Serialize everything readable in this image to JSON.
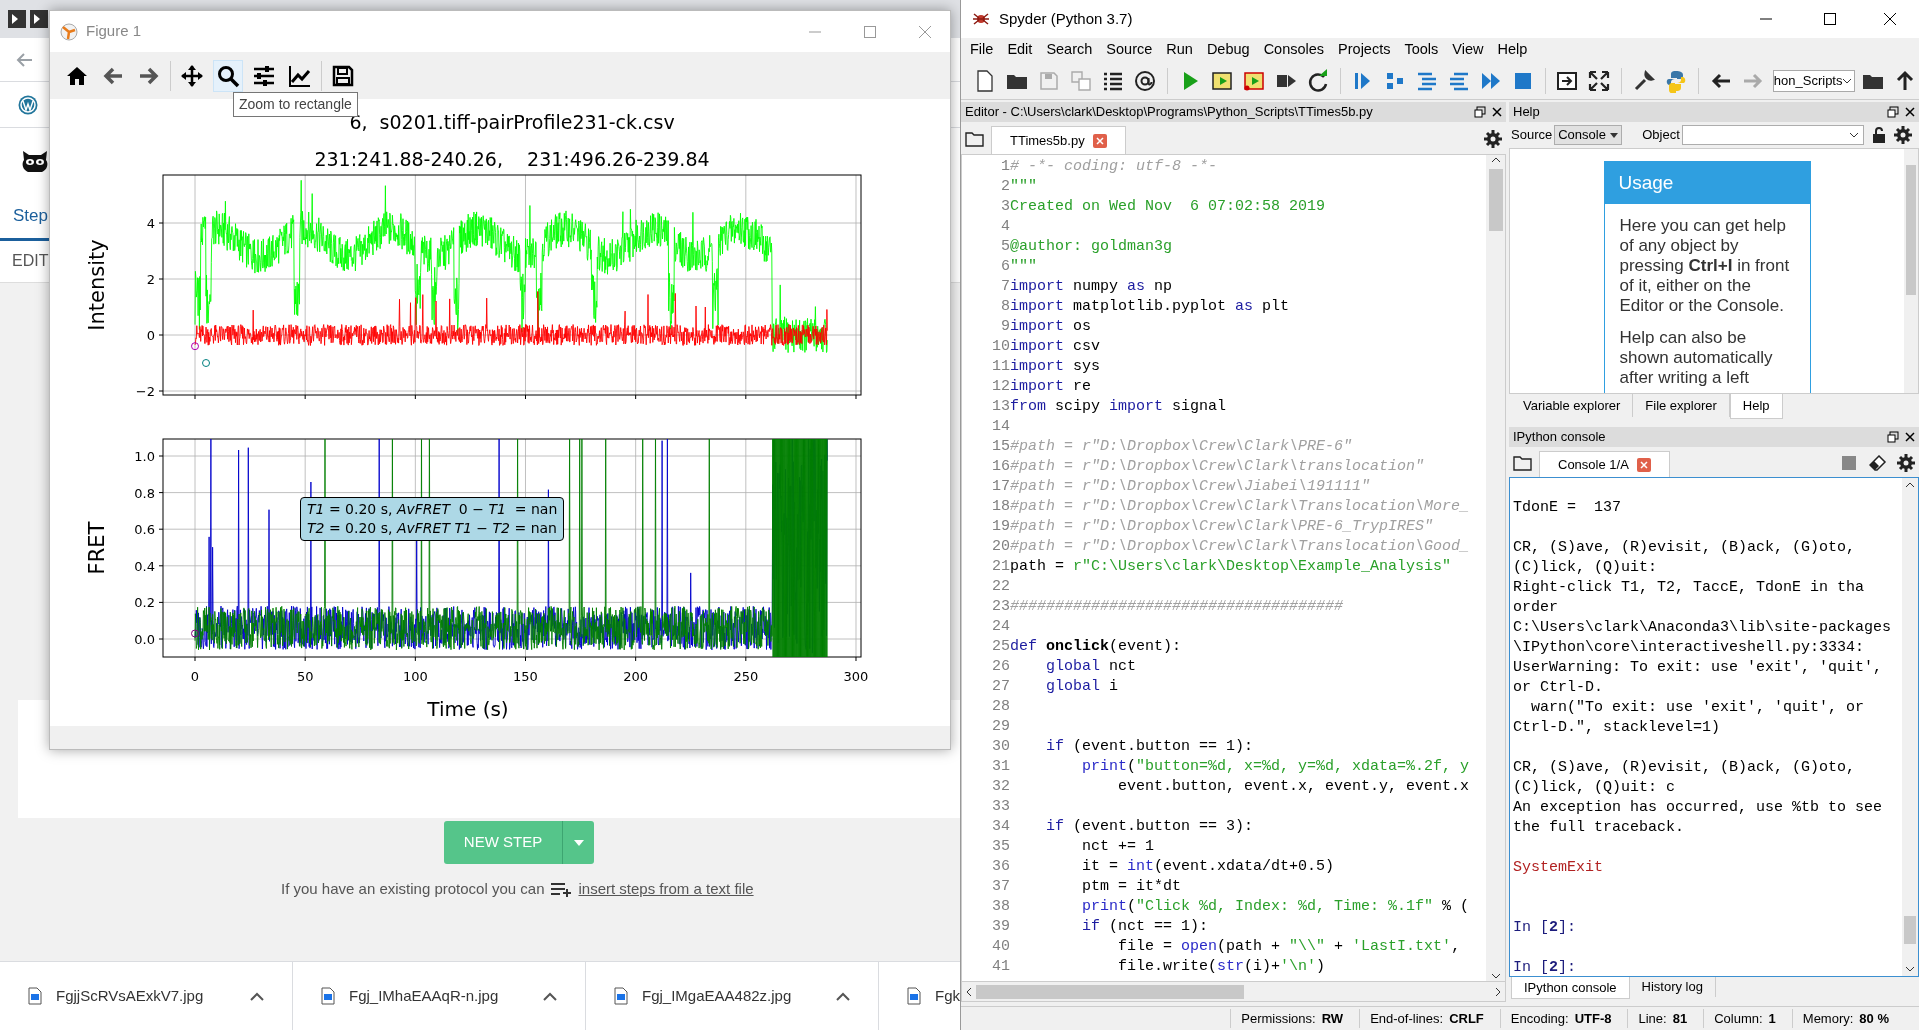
{
  "browser": {
    "tab_label": "Step",
    "edit_label": "EDIT",
    "new_step_button": "NEW STEP",
    "import_hint": "If you have an existing protocol you can",
    "import_link": "insert steps from a text file"
  },
  "downloads": [
    {
      "name": "FgjjScRVsAExkV7.jpg"
    },
    {
      "name": "Fgj_IMhaEAAqR-n.jpg"
    },
    {
      "name": "Fgj_IMgaEAA482z.jpg"
    },
    {
      "name": "Fgk"
    }
  ],
  "figure": {
    "window_title": "Figure 1",
    "tools": [
      {
        "kind": "home",
        "highlighted": false
      },
      {
        "kind": "back",
        "highlighted": false
      },
      {
        "kind": "forward",
        "highlighted": false
      },
      {
        "kind": "pan",
        "highlighted": false
      },
      {
        "kind": "zoom",
        "highlighted": true
      },
      {
        "kind": "sliders",
        "highlighted": false
      },
      {
        "kind": "curve",
        "highlighted": false
      },
      {
        "kind": "save",
        "highlighted": false
      }
    ],
    "tooltip": "Zoom to rectangle",
    "title_lines": [
      "6,  s0201.tiff-pairProfile231-ck.csv",
      "231:241.88-240.26,    231:496.26-239.84"
    ],
    "axes": [
      {
        "ylabel": "Intensity",
        "yticks": [
          "4",
          "2",
          "0",
          "−2"
        ]
      },
      {
        "ylabel": "FRET",
        "yticks": [
          "1.0",
          "0.8",
          "0.6",
          "0.4",
          "0.2",
          "0.0"
        ],
        "annotation": [
          "*T1* = 0.20 s, *AvFRET*  0 − *T1*  = nan",
          "*T2* = 0.20 s, *AvFRET* *T1* − *T2* = nan"
        ]
      }
    ],
    "xticks": [
      "0",
      "50",
      "100",
      "150",
      "200",
      "250",
      "300"
    ],
    "xlabel": "Time (s)"
  },
  "spyder": {
    "window_title": "Spyder (Python 3.7)",
    "menu": [
      "File",
      "Edit",
      "Search",
      "Source",
      "Run",
      "Debug",
      "Consoles",
      "Projects",
      "Tools",
      "View",
      "Help"
    ],
    "path_combo": "hon_Scripts",
    "editor": {
      "pane_title": "Editor - C:\\Users\\clark\\Desktop\\Programs\\Python_Scripts\\TTimes5b.py",
      "tab": "TTimes5b.py",
      "lines": [
        {
          "n": "1",
          "tokens": [
            {
              "kind": "comment",
              "text": "# -*- coding: utf-8 -*-"
            }
          ]
        },
        {
          "n": "2",
          "tokens": [
            {
              "kind": "string",
              "text": "\"\"\""
            }
          ]
        },
        {
          "n": "3",
          "tokens": [
            {
              "kind": "string",
              "text": "Created on Wed Nov  6 07:02:58 2019"
            }
          ]
        },
        {
          "n": "4"
        },
        {
          "n": "5",
          "tokens": [
            {
              "kind": "string",
              "text": "@author: goldman3g"
            }
          ]
        },
        {
          "n": "6",
          "tokens": [
            {
              "kind": "string",
              "text": "\"\"\""
            }
          ]
        },
        {
          "n": "7",
          "tokens": [
            {
              "kind": "keyword",
              "text": "import"
            },
            {
              "kind": "plain",
              "text": " numpy "
            },
            {
              "kind": "keyword",
              "text": "as"
            },
            {
              "kind": "plain",
              "text": " np"
            }
          ]
        },
        {
          "n": "8",
          "tokens": [
            {
              "kind": "keyword",
              "text": "import"
            },
            {
              "kind": "plain",
              "text": " matplotlib.pyplot "
            },
            {
              "kind": "keyword",
              "text": "as"
            },
            {
              "kind": "plain",
              "text": " plt"
            }
          ]
        },
        {
          "n": "9",
          "tokens": [
            {
              "kind": "keyword",
              "text": "import"
            },
            {
              "kind": "plain",
              "text": " os"
            }
          ]
        },
        {
          "n": "10",
          "tokens": [
            {
              "kind": "keyword",
              "text": "import"
            },
            {
              "kind": "plain",
              "text": " csv"
            }
          ]
        },
        {
          "n": "11",
          "tokens": [
            {
              "kind": "keyword",
              "text": "import"
            },
            {
              "kind": "plain",
              "text": " sys"
            }
          ]
        },
        {
          "n": "12",
          "tokens": [
            {
              "kind": "keyword",
              "text": "import"
            },
            {
              "kind": "plain",
              "text": " re"
            }
          ]
        },
        {
          "n": "13",
          "tokens": [
            {
              "kind": "keyword",
              "text": "from"
            },
            {
              "kind": "plain",
              "text": " scipy "
            },
            {
              "kind": "keyword",
              "text": "import"
            },
            {
              "kind": "plain",
              "text": " signal"
            }
          ]
        },
        {
          "n": "14"
        },
        {
          "n": "15",
          "tokens": [
            {
              "kind": "comment",
              "text": "#path = r\"D:\\Dropbox\\Crew\\Clark\\PRE-6\""
            }
          ]
        },
        {
          "n": "16",
          "tokens": [
            {
              "kind": "comment",
              "text": "#path = r\"D:\\Dropbox\\Crew\\Clark\\translocation\""
            }
          ]
        },
        {
          "n": "17",
          "tokens": [
            {
              "kind": "comment",
              "text": "#path = r\"D:\\Dropbox\\Crew\\Jiabei\\191111\""
            }
          ]
        },
        {
          "n": "18",
          "tokens": [
            {
              "kind": "comment",
              "text": "#path = r\"D:\\Dropbox\\Crew\\Clark\\Translocation\\More_"
            }
          ]
        },
        {
          "n": "19",
          "tokens": [
            {
              "kind": "comment",
              "text": "#path = r\"D:\\Dropbox\\Crew\\Clark\\PRE-6_TrypIRES\""
            }
          ]
        },
        {
          "n": "20",
          "tokens": [
            {
              "kind": "comment",
              "text": "#path = r\"D:\\Dropbox\\Crew\\Clark\\Translocation\\Good_"
            }
          ]
        },
        {
          "n": "21",
          "tokens": [
            {
              "kind": "plain",
              "text": "path = "
            },
            {
              "kind": "string",
              "text": "r\"C:\\Users\\clark\\Desktop\\Example_Analysis\""
            }
          ]
        },
        {
          "n": "22"
        },
        {
          "n": "23",
          "tokens": [
            {
              "kind": "comment",
              "text": "#####################################"
            }
          ]
        },
        {
          "n": "24"
        },
        {
          "n": "25",
          "tokens": [
            {
              "kind": "keyword",
              "text": "def"
            },
            {
              "kind": "function",
              "text": " onclick"
            },
            {
              "kind": "plain",
              "text": "(event):"
            }
          ]
        },
        {
          "n": "26",
          "tokens": [
            {
              "kind": "keyword",
              "text": "    global"
            },
            {
              "kind": "plain",
              "text": " nct"
            }
          ]
        },
        {
          "n": "27",
          "tokens": [
            {
              "kind": "keyword",
              "text": "    global"
            },
            {
              "kind": "plain",
              "text": " i"
            }
          ]
        },
        {
          "n": "28"
        },
        {
          "n": "29"
        },
        {
          "n": "30",
          "tokens": [
            {
              "kind": "keyword",
              "text": "    if"
            },
            {
              "kind": "plain",
              "text": " (event.button == 1):"
            }
          ]
        },
        {
          "n": "31",
          "tokens": [
            {
              "kind": "builtin",
              "text": "        print"
            },
            {
              "kind": "plain",
              "text": "("
            },
            {
              "kind": "string",
              "text": "\"button=%d, x=%d, y=%d, xdata=%.2f, y"
            }
          ]
        },
        {
          "n": "32",
          "tokens": [
            {
              "kind": "plain",
              "text": "            event.button, event.x, event.y, event.x"
            }
          ]
        },
        {
          "n": "33"
        },
        {
          "n": "34",
          "tokens": [
            {
              "kind": "keyword",
              "text": "    if"
            },
            {
              "kind": "plain",
              "text": " (event.button == 3):"
            }
          ]
        },
        {
          "n": "35",
          "tokens": [
            {
              "kind": "plain",
              "text": "        nct += 1"
            }
          ]
        },
        {
          "n": "36",
          "tokens": [
            {
              "kind": "plain",
              "text": "        it = "
            },
            {
              "kind": "builtin",
              "text": "int"
            },
            {
              "kind": "plain",
              "text": "(event.xdata/dt+0.5)"
            }
          ]
        },
        {
          "n": "37",
          "tokens": [
            {
              "kind": "plain",
              "text": "        ptm = it*dt"
            }
          ]
        },
        {
          "n": "38",
          "tokens": [
            {
              "kind": "builtin",
              "text": "        print"
            },
            {
              "kind": "plain",
              "text": "("
            },
            {
              "kind": "string",
              "text": "\"Click %d, Index: %d, Time: %.1f\""
            },
            {
              "kind": "plain",
              "text": " % ("
            }
          ]
        },
        {
          "n": "39",
          "tokens": [
            {
              "kind": "keyword",
              "text": "        if"
            },
            {
              "kind": "plain",
              "text": " (nct == 1):"
            }
          ]
        },
        {
          "n": "40",
          "tokens": [
            {
              "kind": "plain",
              "text": "            file = "
            },
            {
              "kind": "builtin",
              "text": "open"
            },
            {
              "kind": "plain",
              "text": "(path + "
            },
            {
              "kind": "string",
              "text": "\"\\\\\""
            },
            {
              "kind": "plain",
              "text": " + "
            },
            {
              "kind": "string",
              "text": "'LastI.txt'"
            },
            {
              "kind": "plain",
              "text": ","
            }
          ]
        },
        {
          "n": "41",
          "tokens": [
            {
              "kind": "plain",
              "text": "            file.write("
            },
            {
              "kind": "builtin",
              "text": "str"
            },
            {
              "kind": "plain",
              "text": "(i)+"
            },
            {
              "kind": "string",
              "text": "'\\n'"
            },
            {
              "kind": "plain",
              "text": ")"
            }
          ]
        }
      ]
    },
    "help": {
      "pane_title": "Help",
      "source_label": "Source",
      "source_value": "Console",
      "object_label": "Object",
      "usage_title": "Usage",
      "usage_paragraphs": [
        "Here you can get help of any object by pressing **Ctrl+I** in front of it, either on the Editor or the Console.",
        "Help can also be shown automatically after writing a left"
      ],
      "tabs": [
        {
          "label": "Variable explorer",
          "selected": false
        },
        {
          "label": "File explorer",
          "selected": false
        },
        {
          "label": "Help",
          "selected": true
        }
      ]
    },
    "console": {
      "pane_title": "IPython console",
      "tab": "Console 1/A",
      "lines": [
        {
          "kind": "blank"
        },
        {
          "kind": "text",
          "text": "TdonE =  137"
        },
        {
          "kind": "blank"
        },
        {
          "kind": "text",
          "text": "CR, (S)ave, (R)evisit, (B)ack, (G)oto,"
        },
        {
          "kind": "text",
          "text": "(C)lick, (Q)uit:"
        },
        {
          "kind": "text",
          "text": "Right-click T1, T2, TaccE, TdonE in tha"
        },
        {
          "kind": "text",
          "text": "order"
        },
        {
          "kind": "text",
          "text": "C:\\Users\\clark\\Anaconda3\\lib\\site-packages"
        },
        {
          "kind": "text",
          "text": "\\IPython\\core\\interactiveshell.py:3334:"
        },
        {
          "kind": "text",
          "text": "UserWarning: To exit: use 'exit', 'quit',"
        },
        {
          "kind": "text",
          "text": "or Ctrl-D."
        },
        {
          "kind": "text",
          "text": "  warn(\"To exit: use 'exit', 'quit', or"
        },
        {
          "kind": "text",
          "text": "Ctrl-D.\", stacklevel=1)"
        },
        {
          "kind": "blank"
        },
        {
          "kind": "text",
          "text": "CR, (S)ave, (R)evisit, (B)ack, (G)oto,"
        },
        {
          "kind": "text",
          "text": "(C)lick, (Q)uit: c"
        },
        {
          "kind": "text",
          "text": "An exception has occurred, use %tb to see"
        },
        {
          "kind": "text",
          "text": "the full traceback."
        },
        {
          "kind": "blank"
        },
        {
          "kind": "error",
          "text": "SystemExit"
        },
        {
          "kind": "blank"
        },
        {
          "kind": "blank"
        },
        {
          "kind": "prompt",
          "text": "In [**2**]:"
        },
        {
          "kind": "blank"
        },
        {
          "kind": "prompt",
          "text": "In [**2**]:"
        }
      ],
      "tabs": [
        {
          "label": "IPython console",
          "selected": true
        },
        {
          "label": "History log",
          "selected": false
        }
      ]
    },
    "status": [
      {
        "label": "Permissions:",
        "value": "RW"
      },
      {
        "label": "End-of-lines:",
        "value": "CRLF"
      },
      {
        "label": "Encoding:",
        "value": "UTF-8"
      },
      {
        "label": "Line:",
        "value": "81"
      },
      {
        "label": "Column:",
        "value": "1"
      },
      {
        "label": "Memory:",
        "value": "80 %"
      }
    ]
  }
}
